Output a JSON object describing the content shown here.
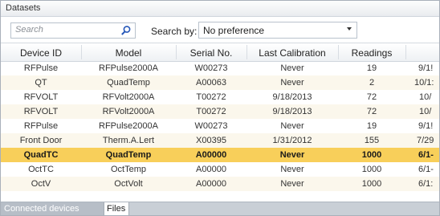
{
  "window": {
    "title": "Datasets"
  },
  "toolbar": {
    "search_placeholder": "Search",
    "search_by_label": "Search by:",
    "search_by_value": "No preference"
  },
  "table": {
    "columns": [
      "Device ID",
      "Model",
      "Serial No.",
      "Last Calibration",
      "Readings",
      ""
    ],
    "rows": [
      [
        "RFPulse",
        "RFPulse2000A",
        "W00273",
        "Never",
        "19",
        "9/1!"
      ],
      [
        "QT",
        "QuadTemp",
        "A00063",
        "Never",
        "2",
        "10/1:"
      ],
      [
        "RFVOLT",
        "RFVolt2000A",
        "T00272",
        "9/18/2013",
        "72",
        "10/"
      ],
      [
        "RFVOLT",
        "RFVolt2000A",
        "T00272",
        "9/18/2013",
        "72",
        "10/"
      ],
      [
        "RFPulse",
        "RFPulse2000A",
        "W00273",
        "Never",
        "19",
        "9/1!"
      ],
      [
        "Front Door",
        "Therm.A.Lert",
        "X00395",
        "1/31/2012",
        "155",
        "7/29"
      ],
      [
        "QuadTC",
        "QuadTemp",
        "A00000",
        "Never",
        "1000",
        "6/1-"
      ],
      [
        "OctTC",
        "OctTemp",
        "A00000",
        "Never",
        "1000",
        "6/1-"
      ],
      [
        "OctV",
        "OctVolt",
        "A00000",
        "Never",
        "1000",
        "6/1:"
      ]
    ],
    "selected_row_index": 6
  },
  "tabs": [
    {
      "label": "Connected devices",
      "active": false
    },
    {
      "label": "Files",
      "active": true
    }
  ],
  "colors": {
    "selected_row": "#f8cf5a",
    "alt_row": "#fbf7ec",
    "tab_bar": "#c9cfd6"
  },
  "icons": {
    "search": "magnifier-icon",
    "dropdown": "chevron-down-icon"
  }
}
